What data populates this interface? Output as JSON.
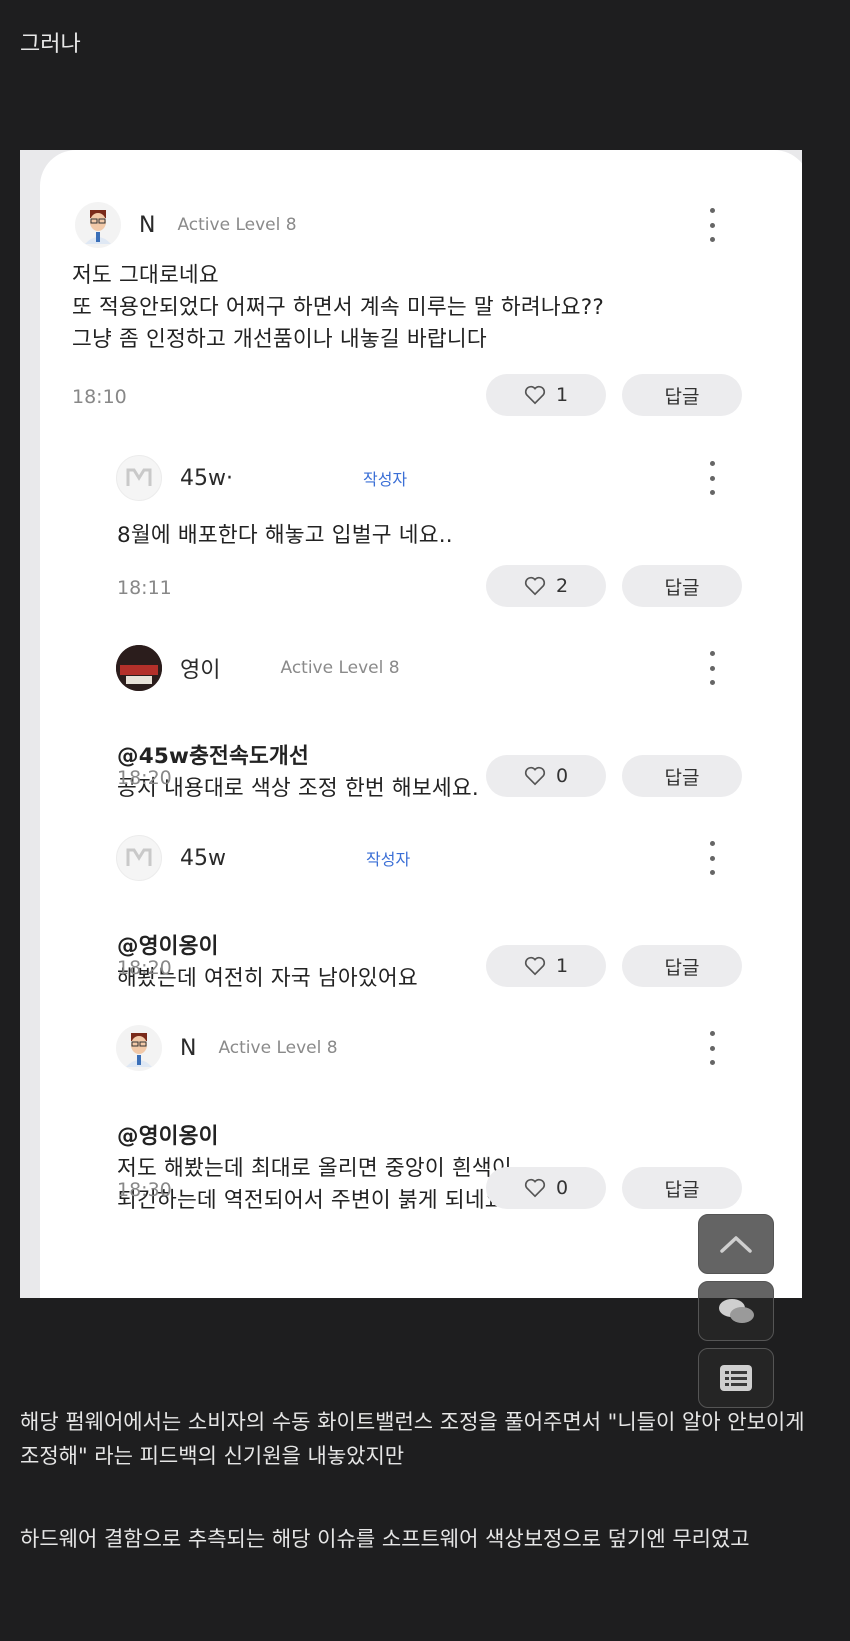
{
  "intro_text": "그러나",
  "comments": [
    {
      "nick": "N",
      "level": "Active Level 8",
      "owner_badge": "",
      "mention": "",
      "text": "저도 그대로네요\n또 적용안되었다 어쩌구 하면서 계속 미루는 말 하려나요??\n그냥 좀 인정하고 개선품이나 내놓길 바랍니다",
      "time": "18:10",
      "likes": "1",
      "reply_label": "답글"
    },
    {
      "nick": "45w·",
      "level": "",
      "owner_badge": "작성자",
      "mention": "",
      "text": "8월에 배포한다 해놓고 입벌구 네요..",
      "time": "18:11",
      "likes": "2",
      "reply_label": "답글"
    },
    {
      "nick": "영이",
      "level": "Active Level 8",
      "owner_badge": "",
      "mention": "@45w충전속도개선",
      "text": "공지 내용대로 색상 조정 한번 해보세요.",
      "time": "18:20",
      "likes": "0",
      "reply_label": "답글"
    },
    {
      "nick": "45w",
      "level": "",
      "owner_badge": "작성자",
      "mention": "@영이옹이",
      "text": "해봤는데 여전히 자국 남아있어요",
      "time": "18:20",
      "likes": "1",
      "reply_label": "답글"
    },
    {
      "nick": "N",
      "level": "Active Level 8",
      "owner_badge": "",
      "mention": "@영이옹이",
      "text": "저도 해봤는데 최대로 올리면 중앙이 흰색이\n되긴하는데 역전되어서 주변이 붉게 되네요",
      "time": "18:30",
      "likes": "0",
      "reply_label": "답글"
    }
  ],
  "paragraphs": [
    "해당 펌웨어에서는 소비자의 수동 화이트밸런스 조정을 풀어주면서 \"니들이 알아 안보이게 조정해\" 라는 피드백의 신기원을 내놓았지만",
    "하드웨어 결함으로 추측되는 해당 이슈를 소프트웨어 색상보정으로 덮기엔 무리였고"
  ],
  "floating_buttons": [
    "chevron-up-icon",
    "chat-bubbles-icon",
    "list-icon"
  ]
}
